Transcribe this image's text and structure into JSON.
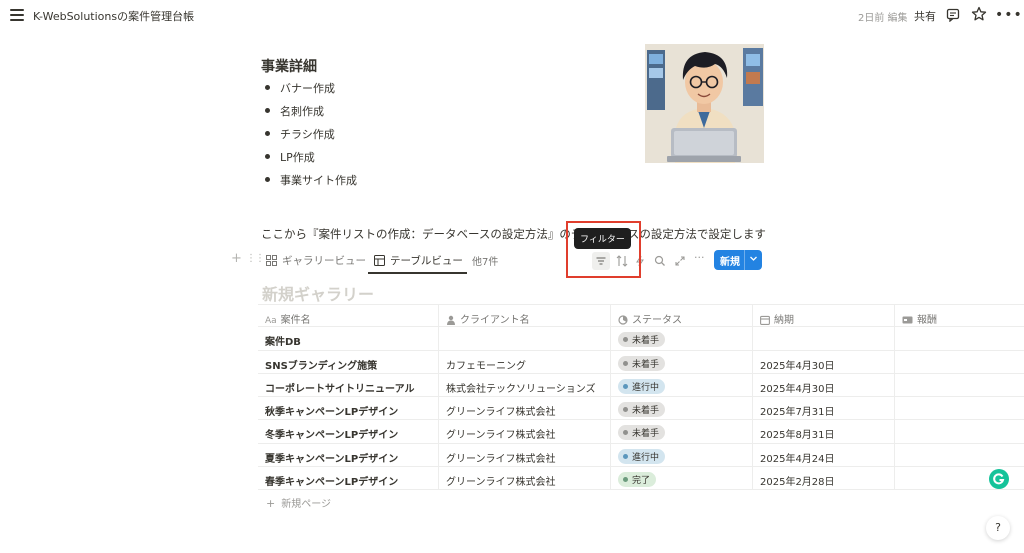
{
  "topbar": {
    "title": "K-WebSolutionsの案件管理台帳",
    "edited": "2日前 編集",
    "share": "共有"
  },
  "content": {
    "heading": "事業詳細",
    "bullets": [
      "バナー作成",
      "名刺作成",
      "チラシ作成",
      "LP作成",
      "事業サイト作成"
    ],
    "description": "ここから『案件リストの作成：データベースの設定方法』のデータベースの設定方法で設定します",
    "tooltip": "フィルター"
  },
  "viewbar": {
    "tabs": [
      {
        "label": "ギャラリービュー",
        "icon": "gallery-icon",
        "active": false
      },
      {
        "label": "テーブルビュー",
        "icon": "table-icon",
        "active": true
      }
    ],
    "more_tabs": "他7件",
    "new_label": "新規"
  },
  "view_title": "新規ギャラリー",
  "table": {
    "columns": [
      {
        "label": "案件名",
        "icon": "text-aa-icon"
      },
      {
        "label": "クライアント名",
        "icon": "person-icon"
      },
      {
        "label": "ステータス",
        "icon": "status-icon"
      },
      {
        "label": "納期",
        "icon": "calendar-icon"
      },
      {
        "label": "報酬",
        "icon": "money-icon"
      }
    ],
    "rows": [
      {
        "name": "案件DB",
        "client": "",
        "status": "未着手",
        "status_key": "todo",
        "deadline": "",
        "reward": ""
      },
      {
        "name": "SNSブランディング施策",
        "client": "カフェモーニング",
        "status": "未着手",
        "status_key": "todo",
        "deadline": "2025年4月30日",
        "reward": ""
      },
      {
        "name": "コーポレートサイトリニューアル",
        "client": "株式会社テックソリューションズ",
        "status": "進行中",
        "status_key": "progress",
        "deadline": "2025年4月30日",
        "reward": ""
      },
      {
        "name": "秋季キャンペーンLPデザイン",
        "client": "グリーンライフ株式会社",
        "status": "未着手",
        "status_key": "todo",
        "deadline": "2025年7月31日",
        "reward": ""
      },
      {
        "name": "冬季キャンペーンLPデザイン",
        "client": "グリーンライフ株式会社",
        "status": "未着手",
        "status_key": "todo",
        "deadline": "2025年8月31日",
        "reward": ""
      },
      {
        "name": "夏季キャンペーンLPデザイン",
        "client": "グリーンライフ株式会社",
        "status": "進行中",
        "status_key": "progress",
        "deadline": "2025年4月24日",
        "reward": ""
      },
      {
        "name": "春季キャンペーンLPデザイン",
        "client": "グリーンライフ株式会社",
        "status": "完了",
        "status_key": "done",
        "deadline": "2025年2月28日",
        "reward": ""
      }
    ],
    "new_page": "新規ページ"
  },
  "status_colors": {
    "todo": {
      "bg": "#e3e2e0",
      "dot": "#91918e"
    },
    "progress": {
      "bg": "#d3e5ef",
      "dot": "#5b97bd"
    },
    "done": {
      "bg": "#dbeddb",
      "dot": "#6c9b7d"
    }
  },
  "colors": {
    "accent": "#2383e2",
    "highlight": "#e03e2d"
  }
}
